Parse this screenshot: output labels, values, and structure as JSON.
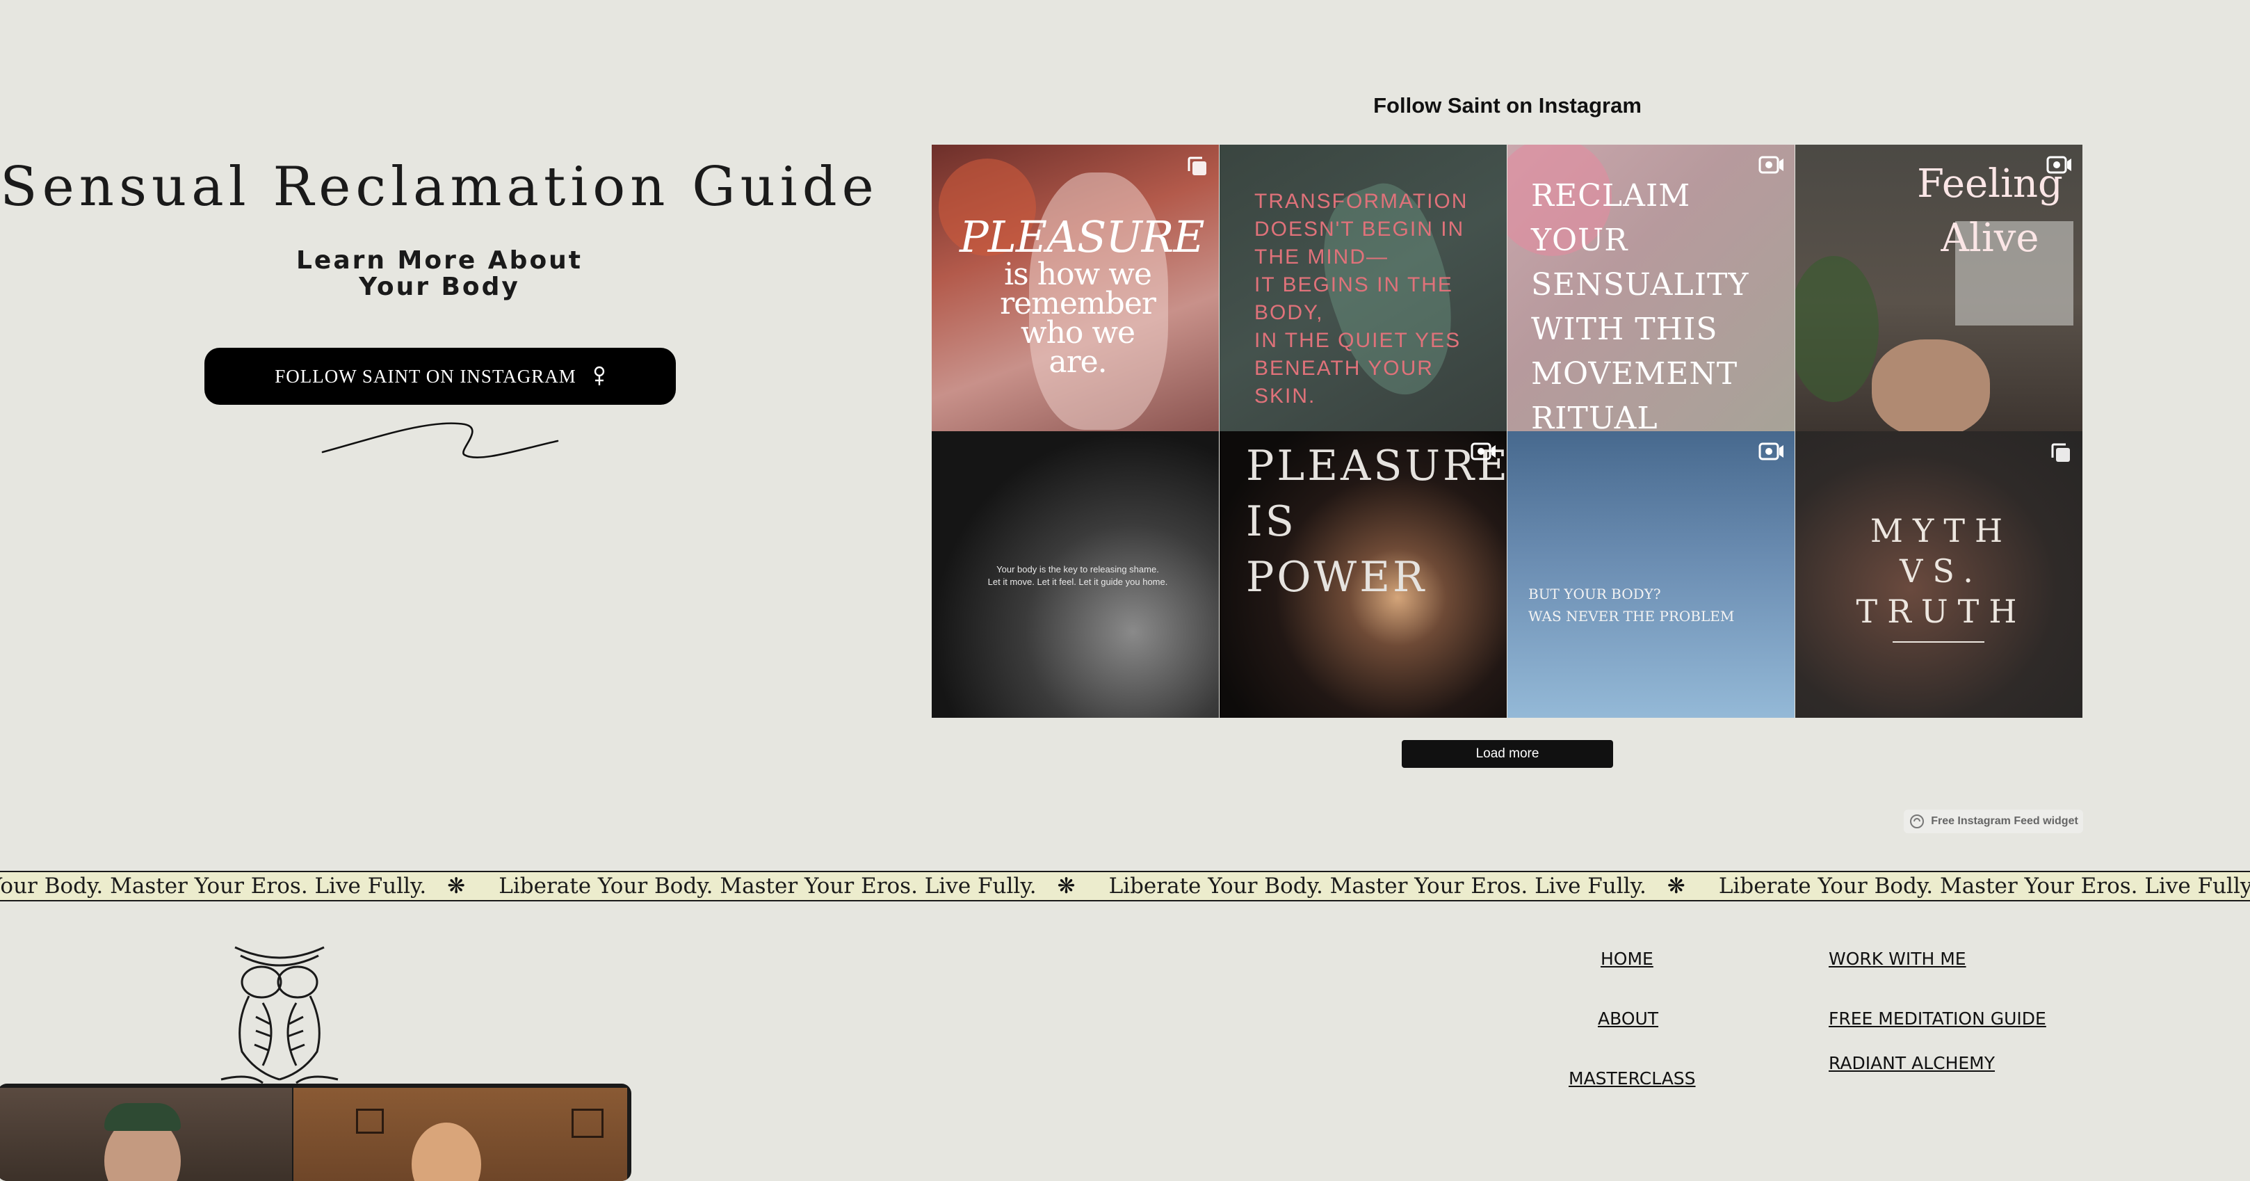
{
  "hero": {
    "title": "Sensual Reclamation Guide",
    "subtitle_line1": "Learn More About",
    "subtitle_line2": "Your Body",
    "cta_label": "FOLLOW SAINT ON INSTAGRAM"
  },
  "instagram": {
    "heading": "Follow Saint on Instagram",
    "load_more_label": "Load more",
    "widget_label": "Free Instagram Feed widget",
    "posts": [
      {
        "lines": [
          "PLEASURE",
          "is how we",
          "remember",
          "who we",
          "are."
        ],
        "badge": "carousel-icon"
      },
      {
        "lines": [
          "TRANSFORMATION",
          "DOESN'T BEGIN IN",
          "THE MIND—",
          "IT BEGINS IN THE",
          "BODY,",
          "IN THE QUIET YES",
          "BENEATH YOUR SKIN."
        ],
        "badge": ""
      },
      {
        "lines": [
          "RECLAIM YOUR",
          "SENSUALITY",
          "WITH THIS",
          "MOVEMENT",
          "RITUAL"
        ],
        "badge": "reel-icon"
      },
      {
        "lines": [
          "Feeling",
          "Alive"
        ],
        "badge": "reel-icon"
      },
      {
        "lines": [
          "Your body is the key to releasing shame.",
          "Let it move. Let it feel. Let it guide you home."
        ],
        "badge": ""
      },
      {
        "lines": [
          "PLEASURE",
          "IS",
          "POWER"
        ],
        "badge": "reel-icon"
      },
      {
        "lines": [
          "BUT YOUR BODY?",
          "WAS NEVER THE PROBLEM"
        ],
        "badge": "reel-icon"
      },
      {
        "lines": [
          "MYTH",
          "VS.",
          "TRUTH"
        ],
        "badge": "carousel-icon"
      }
    ]
  },
  "marquee": {
    "text": "Liberate Your Body. Master Your Eros. Live Fully.",
    "separator": "❋"
  },
  "footer": {
    "nav_col1": [
      "HOME",
      "ABOUT",
      "MASTERCLASS"
    ],
    "nav_col2": [
      "WORK WITH ME",
      "FREE MEDITATION GUIDE",
      "RADIANT ALCHEMY"
    ]
  }
}
